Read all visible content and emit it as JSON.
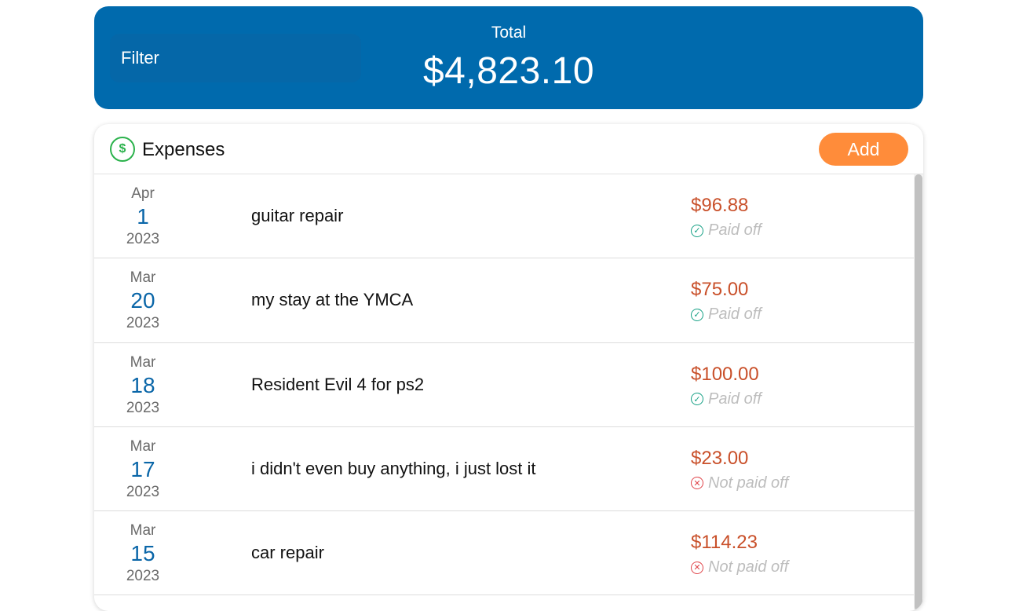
{
  "header": {
    "filter_label": "Filter",
    "total_label": "Total",
    "total_value": "$4,823.10"
  },
  "expenses": {
    "title": "Expenses",
    "icon": "dollar-circle-icon",
    "add_label": "Add",
    "items": [
      {
        "month": "Apr",
        "day": "1",
        "year": "2023",
        "description": "guitar repair",
        "amount": "$96.88",
        "status": "Paid off",
        "paid": true
      },
      {
        "month": "Mar",
        "day": "20",
        "year": "2023",
        "description": "my stay at the YMCA",
        "amount": "$75.00",
        "status": "Paid off",
        "paid": true
      },
      {
        "month": "Mar",
        "day": "18",
        "year": "2023",
        "description": "Resident Evil 4 for ps2",
        "amount": "$100.00",
        "status": "Paid off",
        "paid": true
      },
      {
        "month": "Mar",
        "day": "17",
        "year": "2023",
        "description": "i didn't even buy anything, i just lost it",
        "amount": "$23.00",
        "status": "Not paid off",
        "paid": false
      },
      {
        "month": "Mar",
        "day": "15",
        "year": "2023",
        "description": "car repair",
        "amount": "$114.23",
        "status": "Not paid off",
        "paid": false
      }
    ]
  },
  "colors": {
    "header_bg": "#006aad",
    "add_button": "#ff8c3a",
    "amount": "#c9502a",
    "paid_icon": "#16a085",
    "unpaid_icon": "#e0454a"
  }
}
